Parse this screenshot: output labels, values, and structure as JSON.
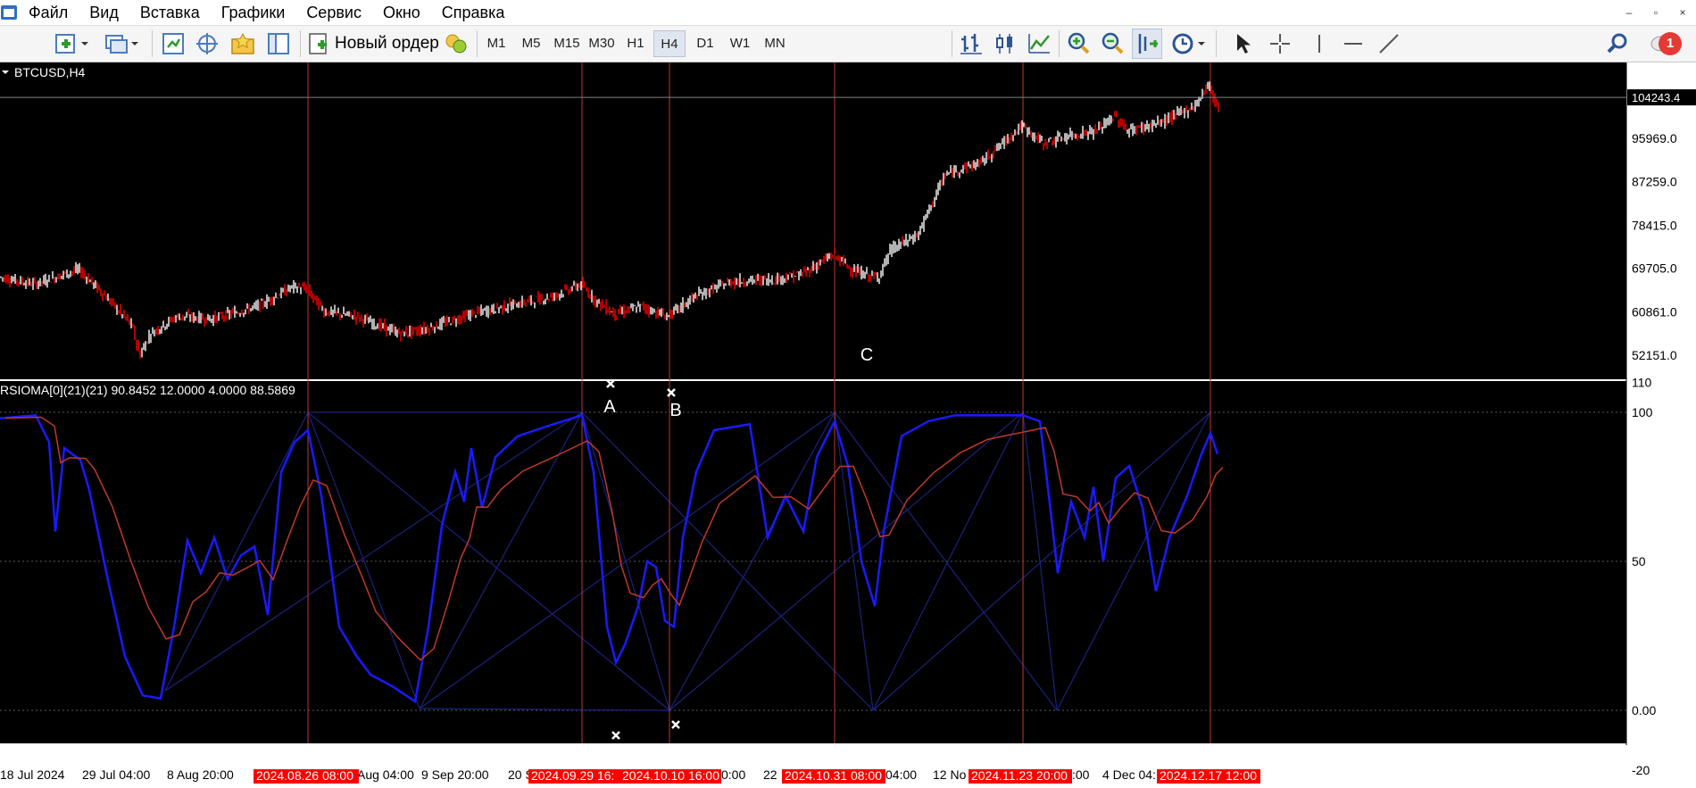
{
  "menu": {
    "items": [
      "Файл",
      "Вид",
      "Вставка",
      "Графики",
      "Сервис",
      "Окно",
      "Справка"
    ]
  },
  "window_controls": [
    "–",
    "▫",
    "×"
  ],
  "toolbar": {
    "new_order_label": "Новый ордер",
    "timeframes": [
      "M1",
      "M5",
      "M15",
      "M30",
      "H1",
      "H4",
      "D1",
      "W1",
      "MN"
    ],
    "active_timeframe": "H4",
    "notification_count": "1"
  },
  "chart": {
    "symbol_label": "BTCUSD,H4",
    "current_price_label": "104243.4",
    "price_axis": [
      "95969.0",
      "87259.0",
      "78415.0",
      "69705.0",
      "60861.0",
      "52151.0"
    ],
    "price_axis_values": [
      95969.0,
      87259.0,
      78415.0,
      69705.0,
      60861.0,
      52151.0
    ],
    "current_price": 104243.4,
    "point_labels_price": [
      "A",
      "B",
      "C"
    ],
    "indicator_label": "RSIOMA[0](21)(21) 90.8452 12.0000 4.0000 88.5869",
    "indicator_axis": [
      "110",
      "100",
      "50",
      "0.00",
      "-20"
    ],
    "indicator_axis_values": [
      110,
      100,
      50,
      0,
      -20
    ],
    "point_labels_indicator": [
      "A",
      "B",
      "C"
    ],
    "date_axis": [
      "18 Jul 2024",
      "29 Jul 04:00",
      "8 Aug 20:00",
      "Aug 04:00",
      "9 Sep 20:00",
      "20 S",
      "0:00",
      "22",
      "04:00",
      "12 No",
      ":00",
      "4 Dec 04:"
    ],
    "highlighted_dates": [
      "2024.08.26 08:00",
      "2024.09.29 16:",
      "2024.10.10 16:00",
      "2024.10.31 08:00",
      "2024.11.23 20:00",
      "2024.12.17 12:00"
    ],
    "colors": {
      "background": "#000000",
      "bull_candle": "#ffffff",
      "bear_candle": "#ff0000",
      "rsi_line": "#1a1aff",
      "signal_line": "#c0392b",
      "zigzag": "#1a237e",
      "vertical_marker": "#c0392b",
      "date_highlight": "#ff0000"
    }
  }
}
